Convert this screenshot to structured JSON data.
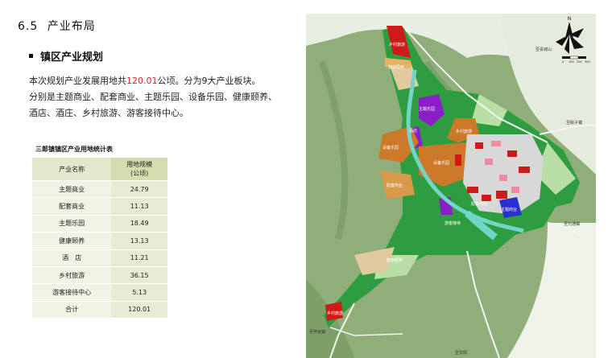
{
  "section": {
    "number": "6.5",
    "title": "产业布局"
  },
  "subsection": {
    "title": "镇区产业规划"
  },
  "paragraph": {
    "before_area": "本次规划产业发展用地共",
    "area_value": "120.01",
    "after_area": "公顷。分为9大产业板块。",
    "line2": "分别是主题商业、配套商业、主题乐园、设备乐园、健康颐养、",
    "line3": "酒店、酒庄、乡村旅游、游客接待中心。"
  },
  "table": {
    "caption": "三郎镇镇区产业用地统计表",
    "header_name": "产业名称",
    "header_area_line1": "用地规模",
    "header_area_line2": "(公顷)",
    "rows": [
      {
        "name": "主题商业",
        "value": "24.79"
      },
      {
        "name": "配套商业",
        "value": "11.13"
      },
      {
        "name": "主题乐园",
        "value": "18.49"
      },
      {
        "name": "健康颐养",
        "value": "13.13"
      },
      {
        "name": "酒　店",
        "value": "11.21"
      },
      {
        "name": "乡村旅游",
        "value": "36.15"
      },
      {
        "name": "游客接待中心",
        "value": "5.13"
      },
      {
        "name": "合计",
        "value": "120.01"
      }
    ]
  },
  "map": {
    "north_label": "N",
    "scale_labels": [
      "0",
      "100",
      "200",
      "300"
    ],
    "direction_labels": {
      "qingcheng": "至青城山",
      "jiezi": "至街子镇",
      "yuantong": "至元通镇",
      "huaiyuan": "至怀远镇",
      "huayang": "至华阳"
    },
    "zone_labels": {
      "village_a": "乡村旅游",
      "health": "健康颐养",
      "theme_park_a": "主题乐园",
      "hotel": "酒店",
      "equip_park_a": "设备乐园",
      "village_b": "乡村旅游",
      "equip_park_b": "设备乐园",
      "support_a": "配套商业",
      "support_b": "配套商业",
      "theme_commerce": "主题商业",
      "visitor": "游客接待",
      "health_b": "健康颐养",
      "village_c": "乡村旅游"
    },
    "colors": {
      "terrain": "#8fae7a",
      "green": "#2e9d3f",
      "orange": "#cc7a2a",
      "purple": "#8a1fc7",
      "red": "#cf1a1a",
      "blue": "#2b2fd0",
      "water": "#6fd6c8",
      "beige": "#e2c9a0"
    }
  }
}
